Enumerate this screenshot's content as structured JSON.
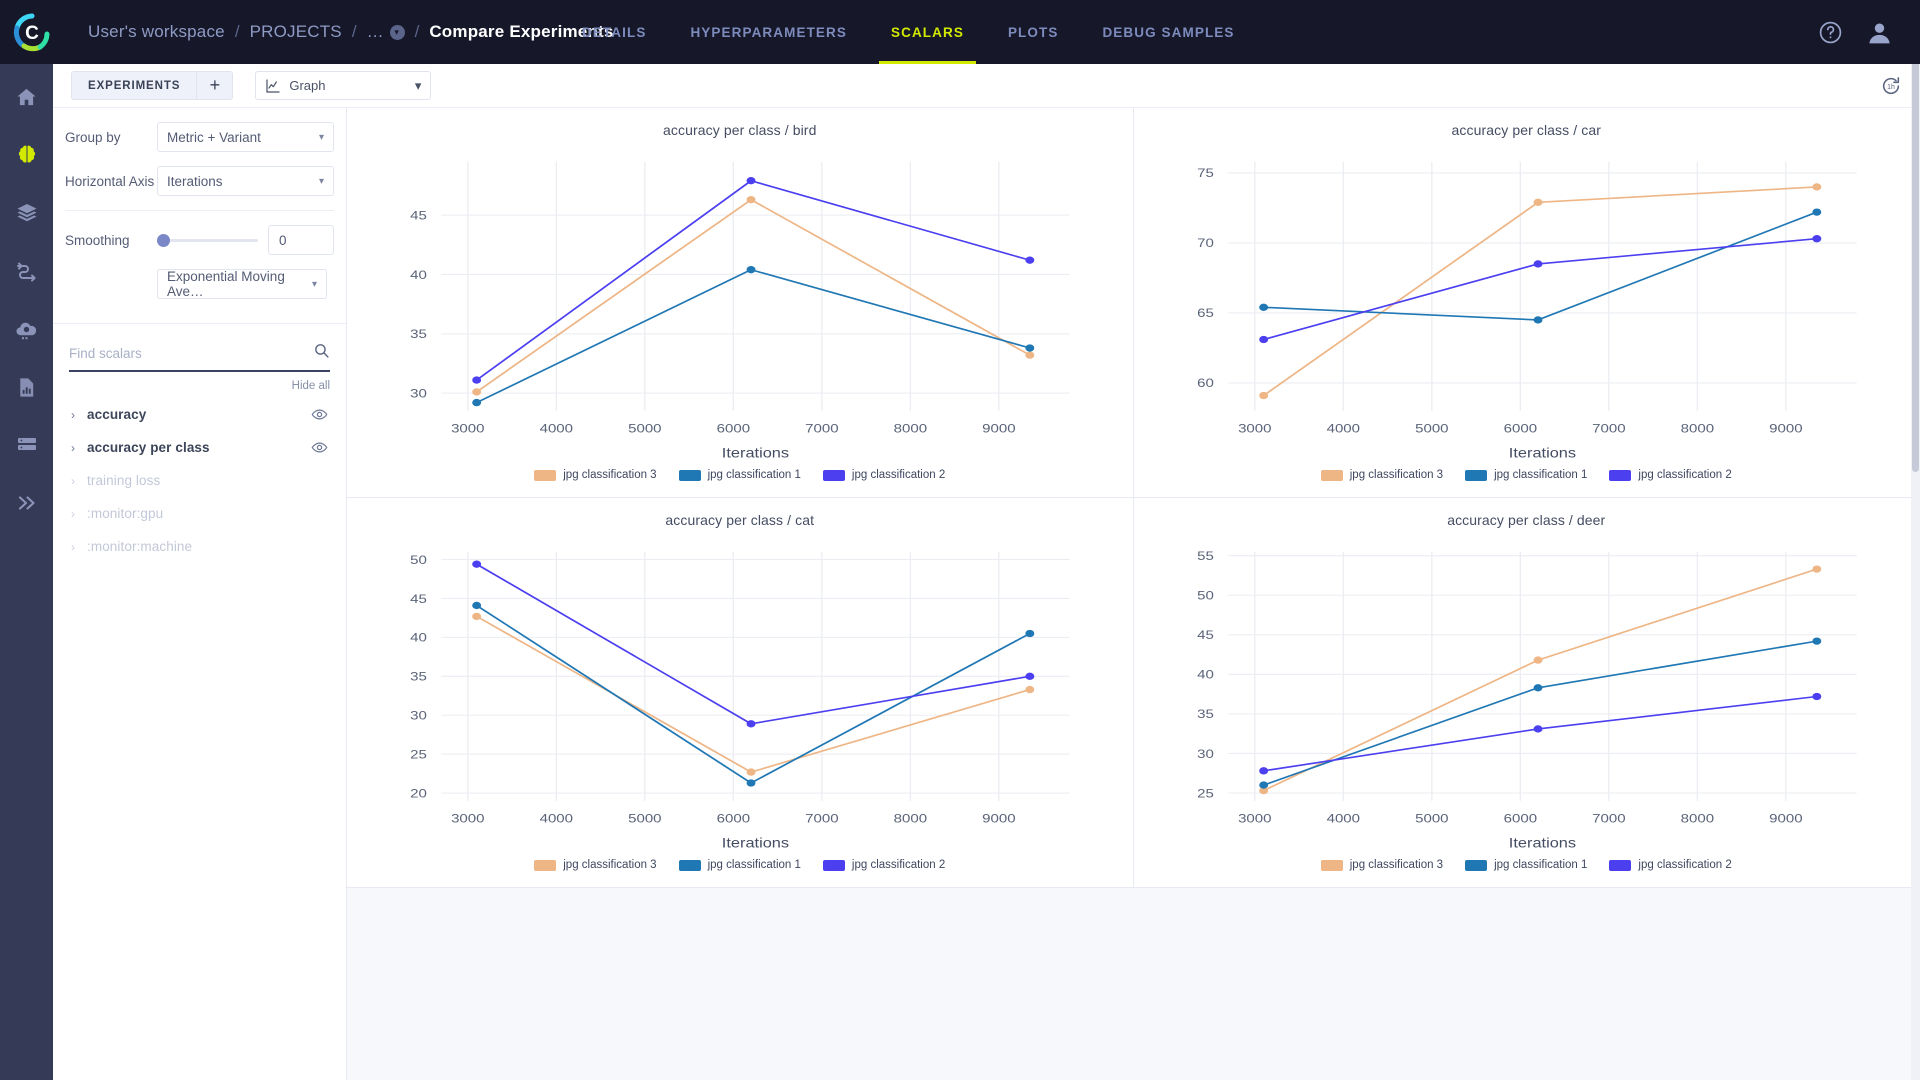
{
  "header": {
    "logo_icon": "clearml-c-logo-icon",
    "breadcrumb": {
      "workspace": "User's workspace",
      "projects": "PROJECTS",
      "ellipsis": "…",
      "current": "Compare Experiments",
      "separator": "/"
    },
    "tabs": [
      {
        "label": "DETAILS",
        "active": false
      },
      {
        "label": "HYPERPARAMETERS",
        "active": false
      },
      {
        "label": "SCALARS",
        "active": true
      },
      {
        "label": "PLOTS",
        "active": false
      },
      {
        "label": "DEBUG SAMPLES",
        "active": false
      }
    ],
    "help_icon": "help-circle-icon",
    "account_icon": "user-account-icon",
    "active_color": "#d2e900",
    "background": "#16182a"
  },
  "rail": {
    "items": [
      {
        "icon": "home-icon",
        "active": false
      },
      {
        "icon": "brain-icon",
        "active": true
      },
      {
        "icon": "layers-icon",
        "active": false
      },
      {
        "icon": "pipelines-icon",
        "active": false
      },
      {
        "icon": "cloud-gear-icon",
        "active": false
      },
      {
        "icon": "report-chart-icon",
        "active": false
      },
      {
        "icon": "datasets-icon",
        "active": false
      },
      {
        "icon": "double-chevron-right-icon",
        "active": false
      }
    ]
  },
  "toolbar": {
    "experiments_label": "EXPERIMENTS",
    "add_label": "+",
    "graph_select": {
      "label": "Graph",
      "icon": "line-chart-icon",
      "caret": "▾"
    },
    "refresh_icon": "refresh-24h-icon"
  },
  "sidebar": {
    "group_by": {
      "label": "Group by",
      "value": "Metric + Variant",
      "caret": "▾"
    },
    "horizontal_axis": {
      "label": "Horizontal Axis",
      "value": "Iterations",
      "caret": "▾"
    },
    "smoothing": {
      "label": "Smoothing",
      "value": "0",
      "slider_position_pct": 0
    },
    "algorithm": {
      "value": "Exponential Moving Ave…",
      "caret": "▾"
    },
    "search": {
      "placeholder": "Find scalars",
      "value": "",
      "icon": "search-icon"
    },
    "hide_all_label": "Hide all",
    "scalars": [
      {
        "name": "accuracy",
        "caret": "›",
        "disabled": false,
        "eye_icon": "eye-icon"
      },
      {
        "name": "accuracy per class",
        "caret": "›",
        "disabled": false,
        "eye_icon": "eye-icon"
      },
      {
        "name": "training loss",
        "caret": "›",
        "disabled": true,
        "eye_icon": ""
      },
      {
        "name": ":monitor:gpu",
        "caret": "›",
        "disabled": true,
        "eye_icon": ""
      },
      {
        "name": ":monitor:machine",
        "caret": "›",
        "disabled": true,
        "eye_icon": ""
      }
    ]
  },
  "series_colors": {
    "jpg classification 3": "#eeb585",
    "jpg classification 1": "#1f77b4",
    "jpg classification 2": "#4b3ff0"
  },
  "legend": [
    {
      "label": "jpg classification 3",
      "color": "#eeb585"
    },
    {
      "label": "jpg classification 1",
      "color": "#1f77b4"
    },
    {
      "label": "jpg classification 2",
      "color": "#4b3ff0"
    }
  ],
  "chart_data": [
    {
      "type": "line",
      "title": "accuracy per class / bird",
      "xlabel": "Iterations",
      "ylabel": "",
      "x": [
        3100,
        6200,
        9350
      ],
      "xlim": [
        2700,
        9800
      ],
      "ylim": [
        28.5,
        49.5
      ],
      "xticks": [
        3000,
        4000,
        5000,
        6000,
        7000,
        8000,
        9000
      ],
      "yticks": [
        30,
        35,
        40,
        45
      ],
      "grid": true,
      "legend_position": "bottom",
      "series": [
        {
          "name": "jpg classification 3",
          "color": "#eeb585",
          "values": [
            30.1,
            46.3,
            33.2
          ]
        },
        {
          "name": "jpg classification 1",
          "color": "#1f77b4",
          "values": [
            29.2,
            40.4,
            33.8
          ]
        },
        {
          "name": "jpg classification 2",
          "color": "#4b3ff0",
          "values": [
            31.1,
            47.9,
            41.2
          ]
        }
      ]
    },
    {
      "type": "line",
      "title": "accuracy per class / car",
      "xlabel": "Iterations",
      "ylabel": "",
      "x": [
        3100,
        6200,
        9350
      ],
      "xlim": [
        2700,
        9800
      ],
      "ylim": [
        58.0,
        75.8
      ],
      "xticks": [
        3000,
        4000,
        5000,
        6000,
        7000,
        8000,
        9000
      ],
      "yticks": [
        60,
        65,
        70,
        75
      ],
      "grid": true,
      "legend_position": "bottom",
      "series": [
        {
          "name": "jpg classification 3",
          "color": "#eeb585",
          "values": [
            59.1,
            72.9,
            74.0
          ]
        },
        {
          "name": "jpg classification 1",
          "color": "#1f77b4",
          "values": [
            65.4,
            64.5,
            72.2
          ]
        },
        {
          "name": "jpg classification 2",
          "color": "#4b3ff0",
          "values": [
            63.1,
            68.5,
            70.3
          ]
        }
      ]
    },
    {
      "type": "line",
      "title": "accuracy per class / cat",
      "xlabel": "Iterations",
      "ylabel": "",
      "x": [
        3100,
        6200,
        9350
      ],
      "xlim": [
        2700,
        9800
      ],
      "ylim": [
        19.0,
        51.0
      ],
      "xticks": [
        3000,
        4000,
        5000,
        6000,
        7000,
        8000,
        9000
      ],
      "yticks": [
        20,
        25,
        30,
        35,
        40,
        45,
        50
      ],
      "grid": true,
      "legend_position": "bottom",
      "series": [
        {
          "name": "jpg classification 3",
          "color": "#eeb585",
          "values": [
            42.7,
            22.7,
            33.3
          ]
        },
        {
          "name": "jpg classification 1",
          "color": "#1f77b4",
          "values": [
            44.1,
            21.3,
            40.5
          ]
        },
        {
          "name": "jpg classification 2",
          "color": "#4b3ff0",
          "values": [
            49.4,
            28.9,
            35.0
          ]
        }
      ]
    },
    {
      "type": "line",
      "title": "accuracy per class / deer",
      "xlabel": "Iterations",
      "ylabel": "",
      "x": [
        3100,
        6200,
        9350
      ],
      "xlim": [
        2700,
        9800
      ],
      "ylim": [
        24.0,
        55.5
      ],
      "xticks": [
        3000,
        4000,
        5000,
        6000,
        7000,
        8000,
        9000
      ],
      "yticks": [
        25,
        30,
        35,
        40,
        45,
        50,
        55
      ],
      "grid": true,
      "legend_position": "bottom",
      "series": [
        {
          "name": "jpg classification 3",
          "color": "#eeb585",
          "values": [
            25.3,
            41.8,
            53.3
          ]
        },
        {
          "name": "jpg classification 1",
          "color": "#1f77b4",
          "values": [
            26.0,
            38.3,
            44.2
          ]
        },
        {
          "name": "jpg classification 2",
          "color": "#4b3ff0",
          "values": [
            27.8,
            33.1,
            37.2
          ]
        }
      ]
    }
  ]
}
